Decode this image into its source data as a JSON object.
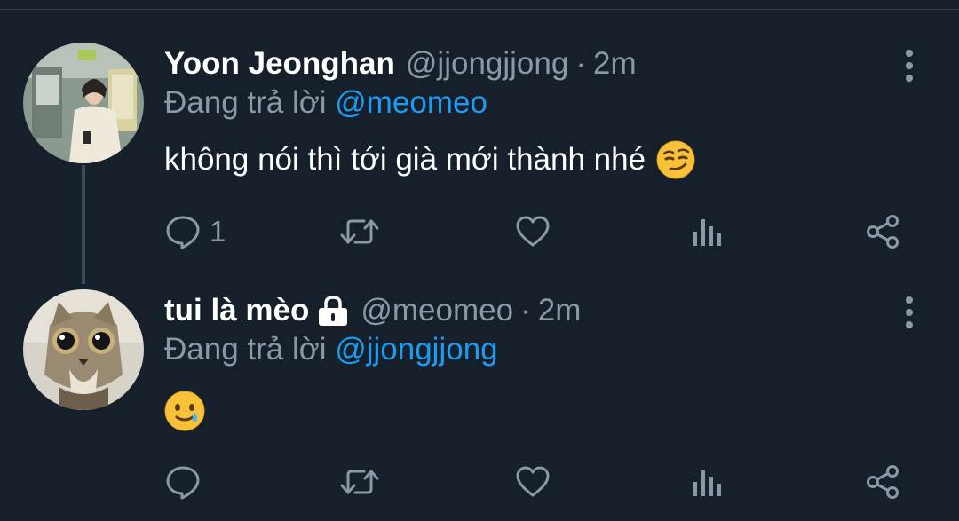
{
  "tweets": [
    {
      "name": "Yoon Jeonghan",
      "handle": "@jjongjjong",
      "separator": "·",
      "time": "2m",
      "reply_prefix": "Đang trả lời",
      "reply_to": "@meomeo",
      "text": "không nói thì tới già mới thành nhé",
      "emoji": "smirking-face",
      "reply_count": "1",
      "protected": false
    },
    {
      "name": "tui là mèo",
      "handle": "@meomeo",
      "separator": "·",
      "time": "2m",
      "reply_prefix": "Đang trả lời",
      "reply_to": "@jjongjjong",
      "text": "",
      "emoji": "smiling-face-with-tear",
      "reply_count": "",
      "protected": true
    }
  ],
  "icons": {
    "reply": "reply-icon",
    "retweet": "retweet-icon",
    "like": "like-icon",
    "views": "views-icon",
    "share": "share-icon",
    "more": "more-vertical-icon",
    "lock": "lock-icon"
  },
  "colors": {
    "background": "#15202b",
    "text_primary": "#ffffff",
    "text_secondary": "#8b98a5",
    "link": "#1d9bf0",
    "divider": "#38444d"
  }
}
